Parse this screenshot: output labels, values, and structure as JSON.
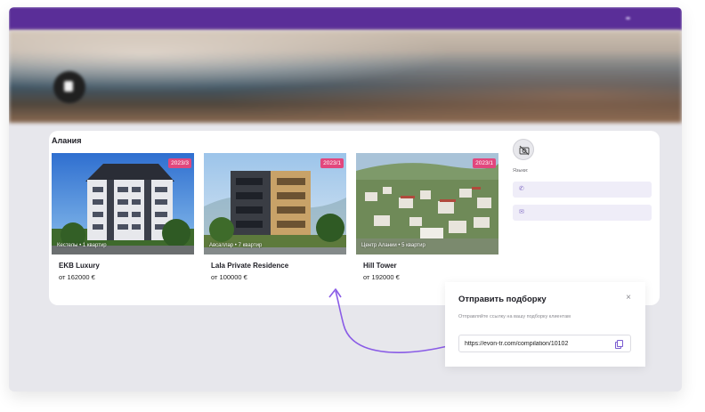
{
  "region": {
    "title": "Алания"
  },
  "properties": [
    {
      "name": "EKB Luxury",
      "price": "от 162000 €",
      "year": "2023/3",
      "caption": "Кестелы • 1 квартир"
    },
    {
      "name": "Lala Private Residence",
      "price": "от 100000 €",
      "year": "2023/1",
      "caption": "Авсаллар • 7 квартир"
    },
    {
      "name": "Hill Tower",
      "price": "от 192000 €",
      "year": "2023/1",
      "caption": "Центр Алании • 5 квартир"
    }
  ],
  "agent": {
    "languages_label": "Языки:",
    "phone_icon": "phone-icon",
    "email_icon": "mail-icon"
  },
  "modal": {
    "title": "Отправить подборку",
    "close": "×",
    "subtitle": "Отправляйте ссылку на вашу подборку клиентам",
    "link": "https://evon-tr.com/compilation/10102"
  },
  "colors": {
    "brand": "#5a2e98",
    "badge": "#e2477d",
    "accent": "#8a5ce6"
  }
}
